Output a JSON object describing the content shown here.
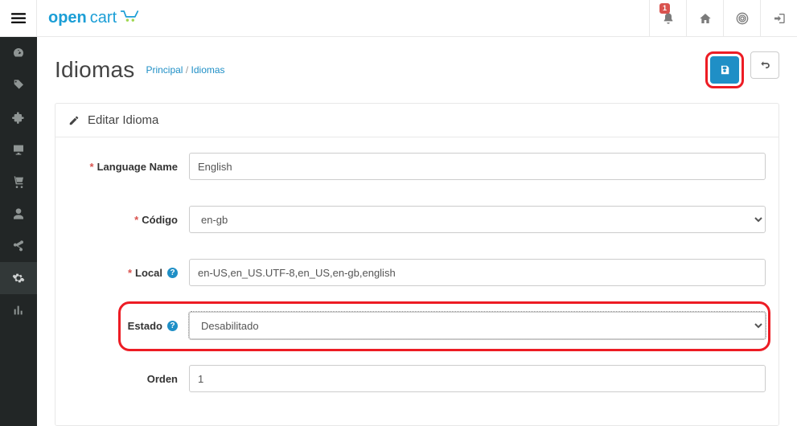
{
  "header": {
    "badge_count": "1"
  },
  "sidebar": {
    "items": [
      {
        "name": "dashboard"
      },
      {
        "name": "catalog"
      },
      {
        "name": "extensions"
      },
      {
        "name": "design"
      },
      {
        "name": "sales"
      },
      {
        "name": "customers"
      },
      {
        "name": "marketing"
      },
      {
        "name": "system"
      },
      {
        "name": "reports"
      }
    ]
  },
  "page": {
    "title": "Idiomas",
    "breadcrumb_home": "Principal",
    "breadcrumb_sep": "/",
    "breadcrumb_current": "Idiomas"
  },
  "panel": {
    "title": "Editar Idioma"
  },
  "form": {
    "language_name": {
      "label": "Language Name",
      "value": "English"
    },
    "codigo": {
      "label": "Código",
      "value": "en-gb"
    },
    "local": {
      "label": "Local",
      "value": "en-US,en_US.UTF-8,en_US,en-gb,english"
    },
    "estado": {
      "label": "Estado",
      "value": "Desabilitado"
    },
    "orden": {
      "label": "Orden",
      "value": "1"
    }
  },
  "colors": {
    "accent": "#1f8fc6",
    "highlight": "#ed1c24",
    "required": "#d9534f"
  }
}
